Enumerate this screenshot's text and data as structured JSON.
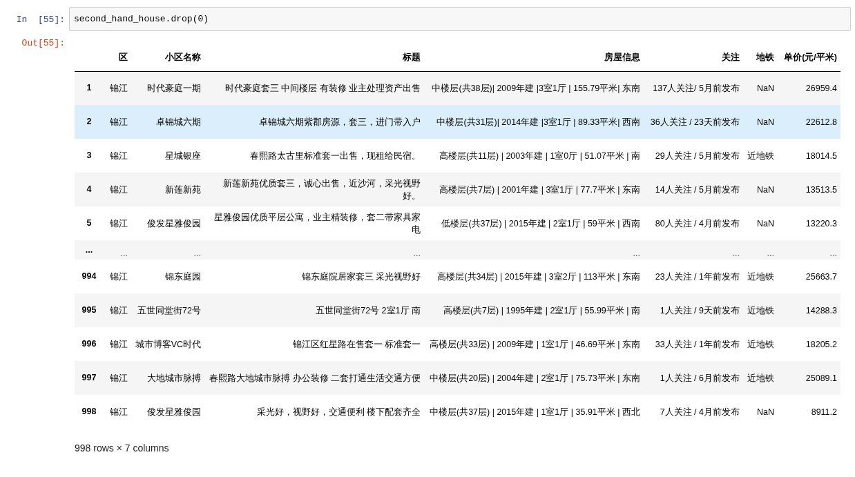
{
  "input_cell": {
    "prompt": "In  [55]:",
    "code": "second_hand_house.drop(0)"
  },
  "output_cell": {
    "prompt": "Out[55]:",
    "table": {
      "columns": [
        "区",
        "小区名称",
        "标题",
        "房屋信息",
        "关注",
        "地铁",
        "单价(元/平米)"
      ],
      "rows": [
        {
          "kind": "data",
          "selected": false,
          "index": "1",
          "cells": [
            "锦江",
            "时代豪庭一期",
            "时代豪庭套三 中间楼层 有装修 业主处理资产出售",
            "中楼层(共38层)| 2009年建 |3室1厅 | 155.79平米| 东南",
            "137人关注/ 5月前发布",
            "NaN",
            "26959.4"
          ]
        },
        {
          "kind": "data",
          "selected": true,
          "index": "2",
          "cells": [
            "锦江",
            "卓锦城六期",
            "卓锦城六期紫郡房源，套三，进门带入户",
            "中楼层(共31层)| 2014年建 |3室1厅 | 89.33平米| 西南",
            "36人关注 / 23天前发布",
            "NaN",
            "22612.8"
          ]
        },
        {
          "kind": "data",
          "selected": false,
          "index": "3",
          "cells": [
            "锦江",
            "星城银座",
            "春熙路太古里标准套一出售，现租给民宿。",
            "高楼层(共11层) | 2003年建 | 1室0厅 | 51.07平米 | 南",
            "29人关注 / 5月前发布",
            "近地铁",
            "18014.5"
          ]
        },
        {
          "kind": "data",
          "selected": false,
          "index": "4",
          "cells": [
            "锦江",
            "新莲新苑",
            "新莲新苑优质套三，诚心出售，近沙河，采光视野好。",
            "高楼层(共7层) | 2001年建 | 3室1厅 | 77.7平米 | 东南",
            "14人关注 / 5月前发布",
            "NaN",
            "13513.5"
          ]
        },
        {
          "kind": "data",
          "selected": false,
          "index": "5",
          "cells": [
            "锦江",
            "俊发星雅俊园",
            "星雅俊园优质平层公寓，业主精装修，套二带家具家电",
            "低楼层(共37层) | 2015年建 | 2室1厅 | 59平米 | 西南",
            "80人关注 / 4月前发布",
            "NaN",
            "13220.3"
          ]
        },
        {
          "kind": "ellipsis",
          "selected": false,
          "index": "...",
          "cells": [
            "...",
            "...",
            "...",
            "...",
            "...",
            "...",
            "..."
          ]
        },
        {
          "kind": "data",
          "selected": false,
          "index": "994",
          "cells": [
            "锦江",
            "锦东庭园",
            "锦东庭院居家套三 采光视野好",
            "高楼层(共34层) | 2015年建 | 3室2厅 | 113平米 | 东南",
            "23人关注 / 1年前发布",
            "近地铁",
            "25663.7"
          ]
        },
        {
          "kind": "data",
          "selected": false,
          "index": "995",
          "cells": [
            "锦江",
            "五世同堂街72号",
            "五世同堂街72号 2室1厅 南",
            "高楼层(共7层) | 1995年建 | 2室1厅 | 55.99平米 | 南",
            "1人关注 / 9天前发布",
            "近地铁",
            "14288.3"
          ]
        },
        {
          "kind": "data",
          "selected": false,
          "index": "996",
          "cells": [
            "锦江",
            "城市博客VC时代",
            "锦江区红星路在售套一 标准套一",
            "高楼层(共33层) | 2009年建 | 1室1厅 | 46.69平米 | 东南",
            "33人关注 / 1年前发布",
            "近地铁",
            "18205.2"
          ]
        },
        {
          "kind": "data",
          "selected": false,
          "index": "997",
          "cells": [
            "锦江",
            "大地城市脉搏",
            "春熙路大地城市脉搏 办公装修 二套打通生活交通方便",
            "中楼层(共20层) | 2004年建 | 2室1厅 | 75.73平米 | 东南",
            "1人关注 / 6月前发布",
            "近地铁",
            "25089.1"
          ]
        },
        {
          "kind": "data",
          "selected": false,
          "index": "998",
          "cells": [
            "锦江",
            "俊发星雅俊园",
            "采光好，视野好，交通便利 楼下配套齐全",
            "中楼层(共37层) | 2015年建 | 1室1厅 | 35.91平米 | 西北",
            "7人关注 / 4月前发布",
            "NaN",
            "8911.2"
          ]
        }
      ]
    },
    "shape_note": "998 rows × 7 columns"
  }
}
